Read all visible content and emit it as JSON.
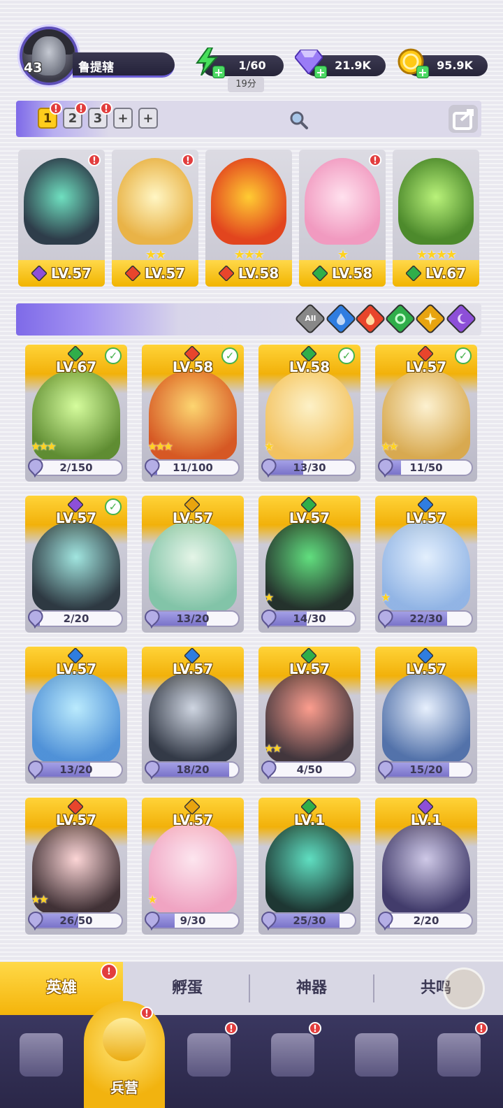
{
  "player": {
    "level": "43",
    "name": "鲁提辖"
  },
  "resources": {
    "energy": {
      "value": "1/60",
      "timer": "19分",
      "icon": "lightning-icon"
    },
    "gems": {
      "value": "21.9K",
      "icon": "diamond-icon"
    },
    "coins": {
      "value": "95.9K",
      "icon": "coin-icon"
    }
  },
  "team_slots": [
    {
      "label": "1",
      "active": true,
      "badge": "!"
    },
    {
      "label": "2",
      "active": false,
      "badge": "!"
    },
    {
      "label": "3",
      "active": false,
      "badge": "!"
    },
    {
      "label": "+",
      "active": false,
      "badge": ""
    },
    {
      "label": "+",
      "active": false,
      "badge": ""
    }
  ],
  "team": [
    {
      "level": "LV.57",
      "stars": "",
      "element": "dark",
      "badge": "!"
    },
    {
      "level": "LV.57",
      "stars": "★★",
      "element": "fire",
      "badge": "!"
    },
    {
      "level": "LV.58",
      "stars": "★★★",
      "element": "fire",
      "badge": ""
    },
    {
      "level": "LV.58",
      "stars": "★",
      "element": "nature",
      "badge": "!"
    },
    {
      "level": "LV.67",
      "stars": "★★★★",
      "element": "nature",
      "badge": ""
    }
  ],
  "filters": {
    "all_label": "All",
    "elements": [
      "water",
      "fire",
      "nature",
      "light",
      "dark"
    ]
  },
  "heroes": [
    {
      "level": "LV.67",
      "element": "nature",
      "progress": "2/150",
      "fraction": 0.013,
      "checked": true,
      "stars": "★★★"
    },
    {
      "level": "LV.58",
      "element": "fire",
      "progress": "11/100",
      "fraction": 0.11,
      "checked": true,
      "stars": "★★★"
    },
    {
      "level": "LV.58",
      "element": "nature",
      "progress": "13/30",
      "fraction": 0.43,
      "checked": true,
      "stars": "★"
    },
    {
      "level": "LV.57",
      "element": "fire",
      "progress": "11/50",
      "fraction": 0.22,
      "checked": true,
      "stars": "★★"
    },
    {
      "level": "LV.57",
      "element": "dark",
      "progress": "2/20",
      "fraction": 0.1,
      "checked": true,
      "stars": ""
    },
    {
      "level": "LV.57",
      "element": "light",
      "progress": "13/20",
      "fraction": 0.65,
      "checked": false,
      "stars": ""
    },
    {
      "level": "LV.57",
      "element": "nature",
      "progress": "14/30",
      "fraction": 0.47,
      "checked": false,
      "stars": "★"
    },
    {
      "level": "LV.57",
      "element": "water",
      "progress": "22/30",
      "fraction": 0.73,
      "checked": false,
      "stars": "★"
    },
    {
      "level": "LV.57",
      "element": "water",
      "progress": "13/20",
      "fraction": 0.65,
      "checked": false,
      "stars": ""
    },
    {
      "level": "LV.57",
      "element": "water",
      "progress": "18/20",
      "fraction": 0.9,
      "checked": false,
      "stars": ""
    },
    {
      "level": "LV.57",
      "element": "nature",
      "progress": "4/50",
      "fraction": 0.08,
      "checked": false,
      "stars": "★★"
    },
    {
      "level": "LV.57",
      "element": "water",
      "progress": "15/20",
      "fraction": 0.75,
      "checked": false,
      "stars": ""
    },
    {
      "level": "LV.57",
      "element": "fire",
      "progress": "26/50",
      "fraction": 0.52,
      "checked": false,
      "stars": "★★"
    },
    {
      "level": "LV.57",
      "element": "light",
      "progress": "9/30",
      "fraction": 0.3,
      "checked": false,
      "stars": "★"
    },
    {
      "level": "LV.1",
      "element": "nature",
      "progress": "25/30",
      "fraction": 0.83,
      "checked": false,
      "stars": ""
    },
    {
      "level": "LV.1",
      "element": "dark",
      "progress": "2/20",
      "fraction": 0.1,
      "checked": false,
      "stars": ""
    }
  ],
  "subtabs": [
    {
      "label": "英雄",
      "active": true,
      "badge": "!"
    },
    {
      "label": "孵蛋",
      "active": false,
      "badge": ""
    },
    {
      "label": "神器",
      "active": false,
      "badge": ""
    },
    {
      "label": "共鸣",
      "active": false,
      "badge": ""
    }
  ],
  "bottom_nav": [
    {
      "name": "cards-icon",
      "label": "",
      "badge": ""
    },
    {
      "name": "barracks-icon",
      "label": "兵营",
      "badge": "!",
      "active": true
    },
    {
      "name": "book-icon",
      "label": "",
      "badge": "!"
    },
    {
      "name": "castle-icon",
      "label": "",
      "badge": "!"
    },
    {
      "name": "guild-icon",
      "label": "",
      "badge": ""
    },
    {
      "name": "banner-icon",
      "label": "",
      "badge": "!"
    }
  ],
  "colors": {
    "fire": "#e8452c",
    "water": "#2f7de0",
    "nature": "#2fae4a",
    "light": "#e8a40f",
    "dark": "#8d4fd8",
    "accent": "#ffcd1c"
  }
}
